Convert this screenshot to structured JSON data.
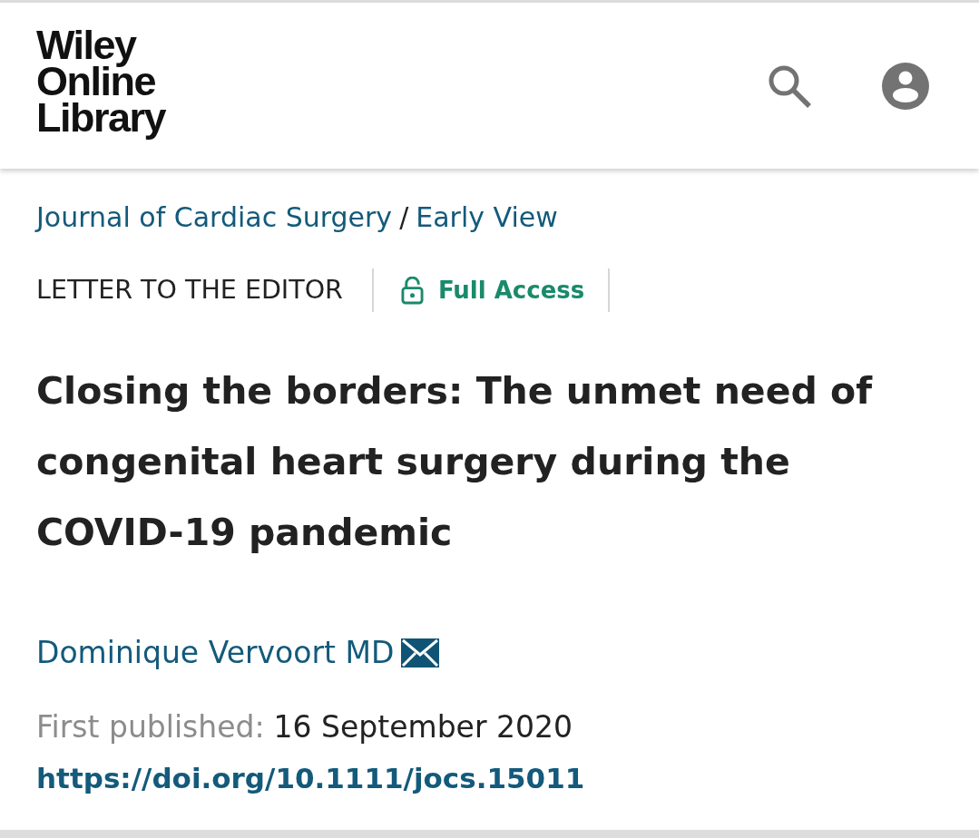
{
  "header": {
    "logo": "Wiley Online Library"
  },
  "breadcrumb": {
    "items": [
      {
        "label": "Journal of Cardiac Surgery"
      },
      {
        "label": "Early View"
      }
    ],
    "separator": "/"
  },
  "article_type": "LETTER TO THE EDITOR",
  "access": {
    "label": "Full Access"
  },
  "title": "Closing the borders: The unmet need of congenital heart surgery during the COVID-19 pandemic",
  "authors": [
    {
      "name": "Dominique Vervoort MD",
      "corresponding": true
    }
  ],
  "published": {
    "label": "First published:",
    "date": "16 September 2020"
  },
  "doi": "https://doi.org/10.1111/jocs.15011"
}
